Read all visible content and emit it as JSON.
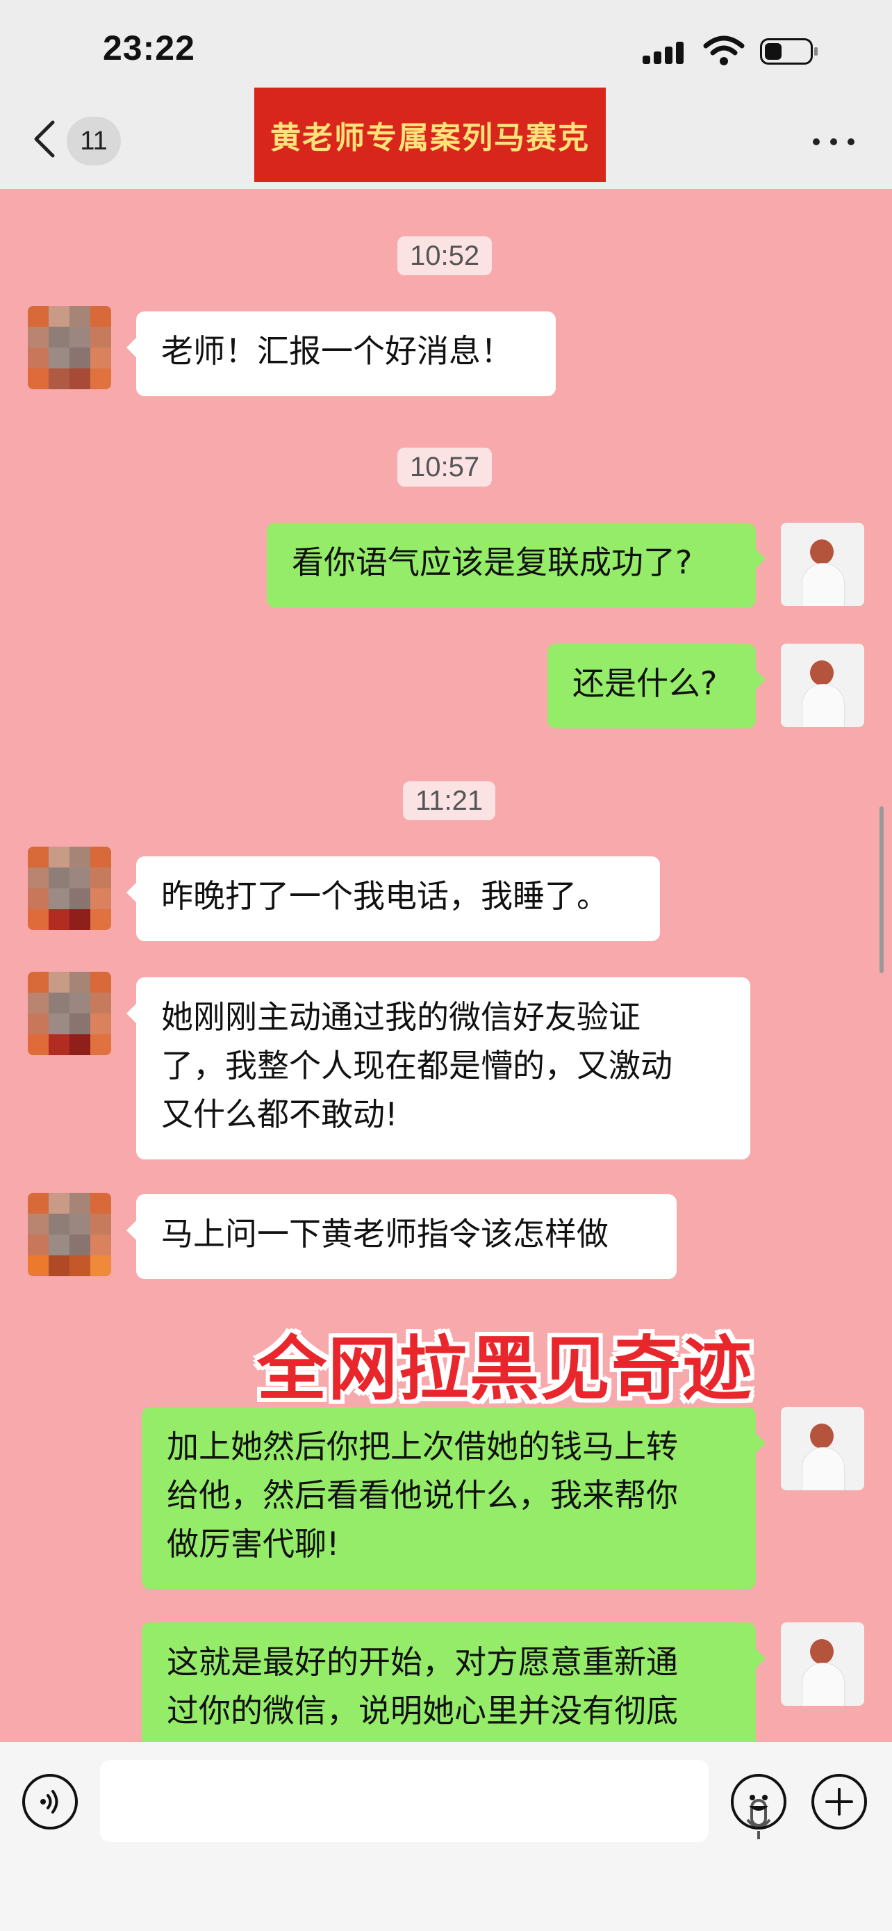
{
  "status_bar": {
    "time": "23:22"
  },
  "nav": {
    "unread_count": "11",
    "title": "黄老师专属案列马赛克",
    "back_icon": "chevron-left-icon",
    "more_icon": "ellipsis-icon"
  },
  "timestamps": [
    "10:52",
    "10:57",
    "11:21"
  ],
  "messages": [
    {
      "side": "in",
      "text": "老师！汇报一个好消息！"
    },
    {
      "side": "out",
      "text": "看你语气应该是复联成功了?"
    },
    {
      "side": "out",
      "text": "还是什么?"
    },
    {
      "side": "in",
      "text": "昨晚打了一个我电话，我睡了。"
    },
    {
      "side": "in",
      "lines": [
        "她刚刚主动通过我的微信好友验证",
        "了，我整个人现在都是懵的，又激动",
        "又什么都不敢动!"
      ]
    },
    {
      "side": "in",
      "text": "马上问一下黄老师指令该怎样做"
    },
    {
      "side": "out",
      "lines": [
        "加上她然后你把上次借她的钱马上转",
        "给他，然后看看他说什么，我来帮你",
        "做厉害代聊!"
      ]
    },
    {
      "side": "out",
      "lines": [
        "这就是最好的开始，对方愿意重新通",
        "过你的微信，说明她心里并没有彻底"
      ]
    }
  ],
  "overlay_text": "全网拉黑见奇迹",
  "input_bar": {
    "voice_icon": "voice-icon",
    "mic_icon": "microphone-icon",
    "emoji_icon": "emoji-icon",
    "add_icon": "plus-icon"
  },
  "colors": {
    "chat_bg": "#f7a9ac",
    "out_bubble": "#95ec69",
    "in_bubble": "#ffffff",
    "banner": "#d9261c"
  }
}
